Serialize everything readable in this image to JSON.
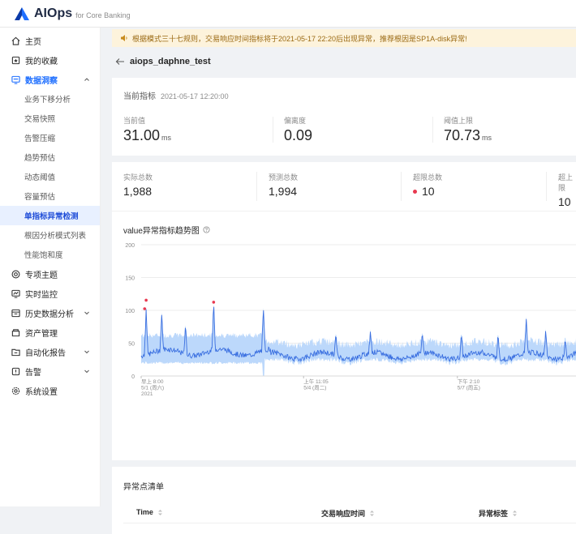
{
  "app": {
    "name": "AIOps",
    "subtitle": "for Core Banking"
  },
  "sidebar": {
    "items": [
      {
        "label": "主页",
        "icon": "home-icon"
      },
      {
        "label": "我的收藏",
        "icon": "favorite-icon"
      },
      {
        "label": "数据洞察",
        "icon": "insight-icon",
        "expanded": true
      },
      {
        "label": "专项主题",
        "icon": "topic-icon"
      },
      {
        "label": "实时监控",
        "icon": "monitor-icon"
      },
      {
        "label": "历史数据分析",
        "icon": "history-icon"
      },
      {
        "label": "资产管理",
        "icon": "asset-icon"
      },
      {
        "label": "自动化报告",
        "icon": "report-icon"
      },
      {
        "label": "告警",
        "icon": "alarm-icon"
      },
      {
        "label": "系统设置",
        "icon": "settings-icon"
      }
    ],
    "sub_items": [
      "业务下移分析",
      "交易快照",
      "告警压缩",
      "趋势预估",
      "动态阈值",
      "容量预估",
      "单指标异常检测",
      "根因分析模式列表",
      "性能饱和度"
    ]
  },
  "notice": {
    "text": "根据模式三十七规则，交易响应时间指标将于2021-05-17 22:20后出现异常，推荐根因是SP1A-disk异常!"
  },
  "breadcrumb": {
    "title": "aiops_daphne_test"
  },
  "current": {
    "title": "当前指标",
    "timestamp": "2021-05-17 12:20:00",
    "stats": [
      {
        "label": "当前值",
        "value": "31.00",
        "unit": "ms"
      },
      {
        "label": "偏离度",
        "value": "0.09",
        "unit": ""
      },
      {
        "label": "阈值上限",
        "value": "70.73",
        "unit": "ms"
      }
    ]
  },
  "summary": [
    {
      "label": "实际总数",
      "value": "1,988"
    },
    {
      "label": "预测总数",
      "value": "1,994"
    },
    {
      "label": "超限总数",
      "value": "10"
    },
    {
      "label": "超上限",
      "value": "10"
    }
  ],
  "chart_title": "value异常指标趋势图",
  "chart_data": {
    "type": "line",
    "title": "value异常指标趋势图",
    "ylim": [
      0,
      200
    ],
    "yticks": [
      "0",
      "50",
      "100",
      "150",
      "200"
    ],
    "xticks": [
      {
        "hour": 0,
        "line1": "早上 8:00",
        "line2": "5/1 (周六)",
        "line3": "2021"
      },
      {
        "hour": 75.08,
        "line1": "上午 11:05",
        "line2": "5/4 (周二)",
        "line3": ""
      },
      {
        "hour": 146.17,
        "line1": "下午 2:10",
        "line2": "5/7 (周五)",
        "line3": ""
      }
    ],
    "x_hours_visible": [
      0,
      201
    ],
    "band_colour": "#bcd8fb",
    "line_colour": "#3a6fe0",
    "anomaly_colour": "#e8384f",
    "anomalies": [
      {
        "hour": 1.6,
        "value": 100
      },
      {
        "hour": 2.3,
        "value": 113
      },
      {
        "hour": 33.5,
        "value": 110
      }
    ],
    "spikes": [
      {
        "hour": 2.3,
        "value": 113
      },
      {
        "hour": 9.5,
        "value": 95
      },
      {
        "hour": 20.5,
        "value": 83
      },
      {
        "hour": 33.5,
        "value": 110
      },
      {
        "hour": 56.5,
        "value": 103
      },
      {
        "hour": 90,
        "value": 72
      },
      {
        "hour": 106,
        "value": 75
      },
      {
        "hour": 130,
        "value": 68
      },
      {
        "hour": 148,
        "value": 74
      },
      {
        "hour": 165,
        "value": 75
      },
      {
        "hour": 178,
        "value": 92
      },
      {
        "hour": 187,
        "value": 78
      },
      {
        "hour": 196,
        "value": 65
      }
    ]
  },
  "anomaly_list": {
    "title": "异常点清单",
    "columns": [
      "Time",
      "交易响应时间",
      "异常标签"
    ]
  }
}
